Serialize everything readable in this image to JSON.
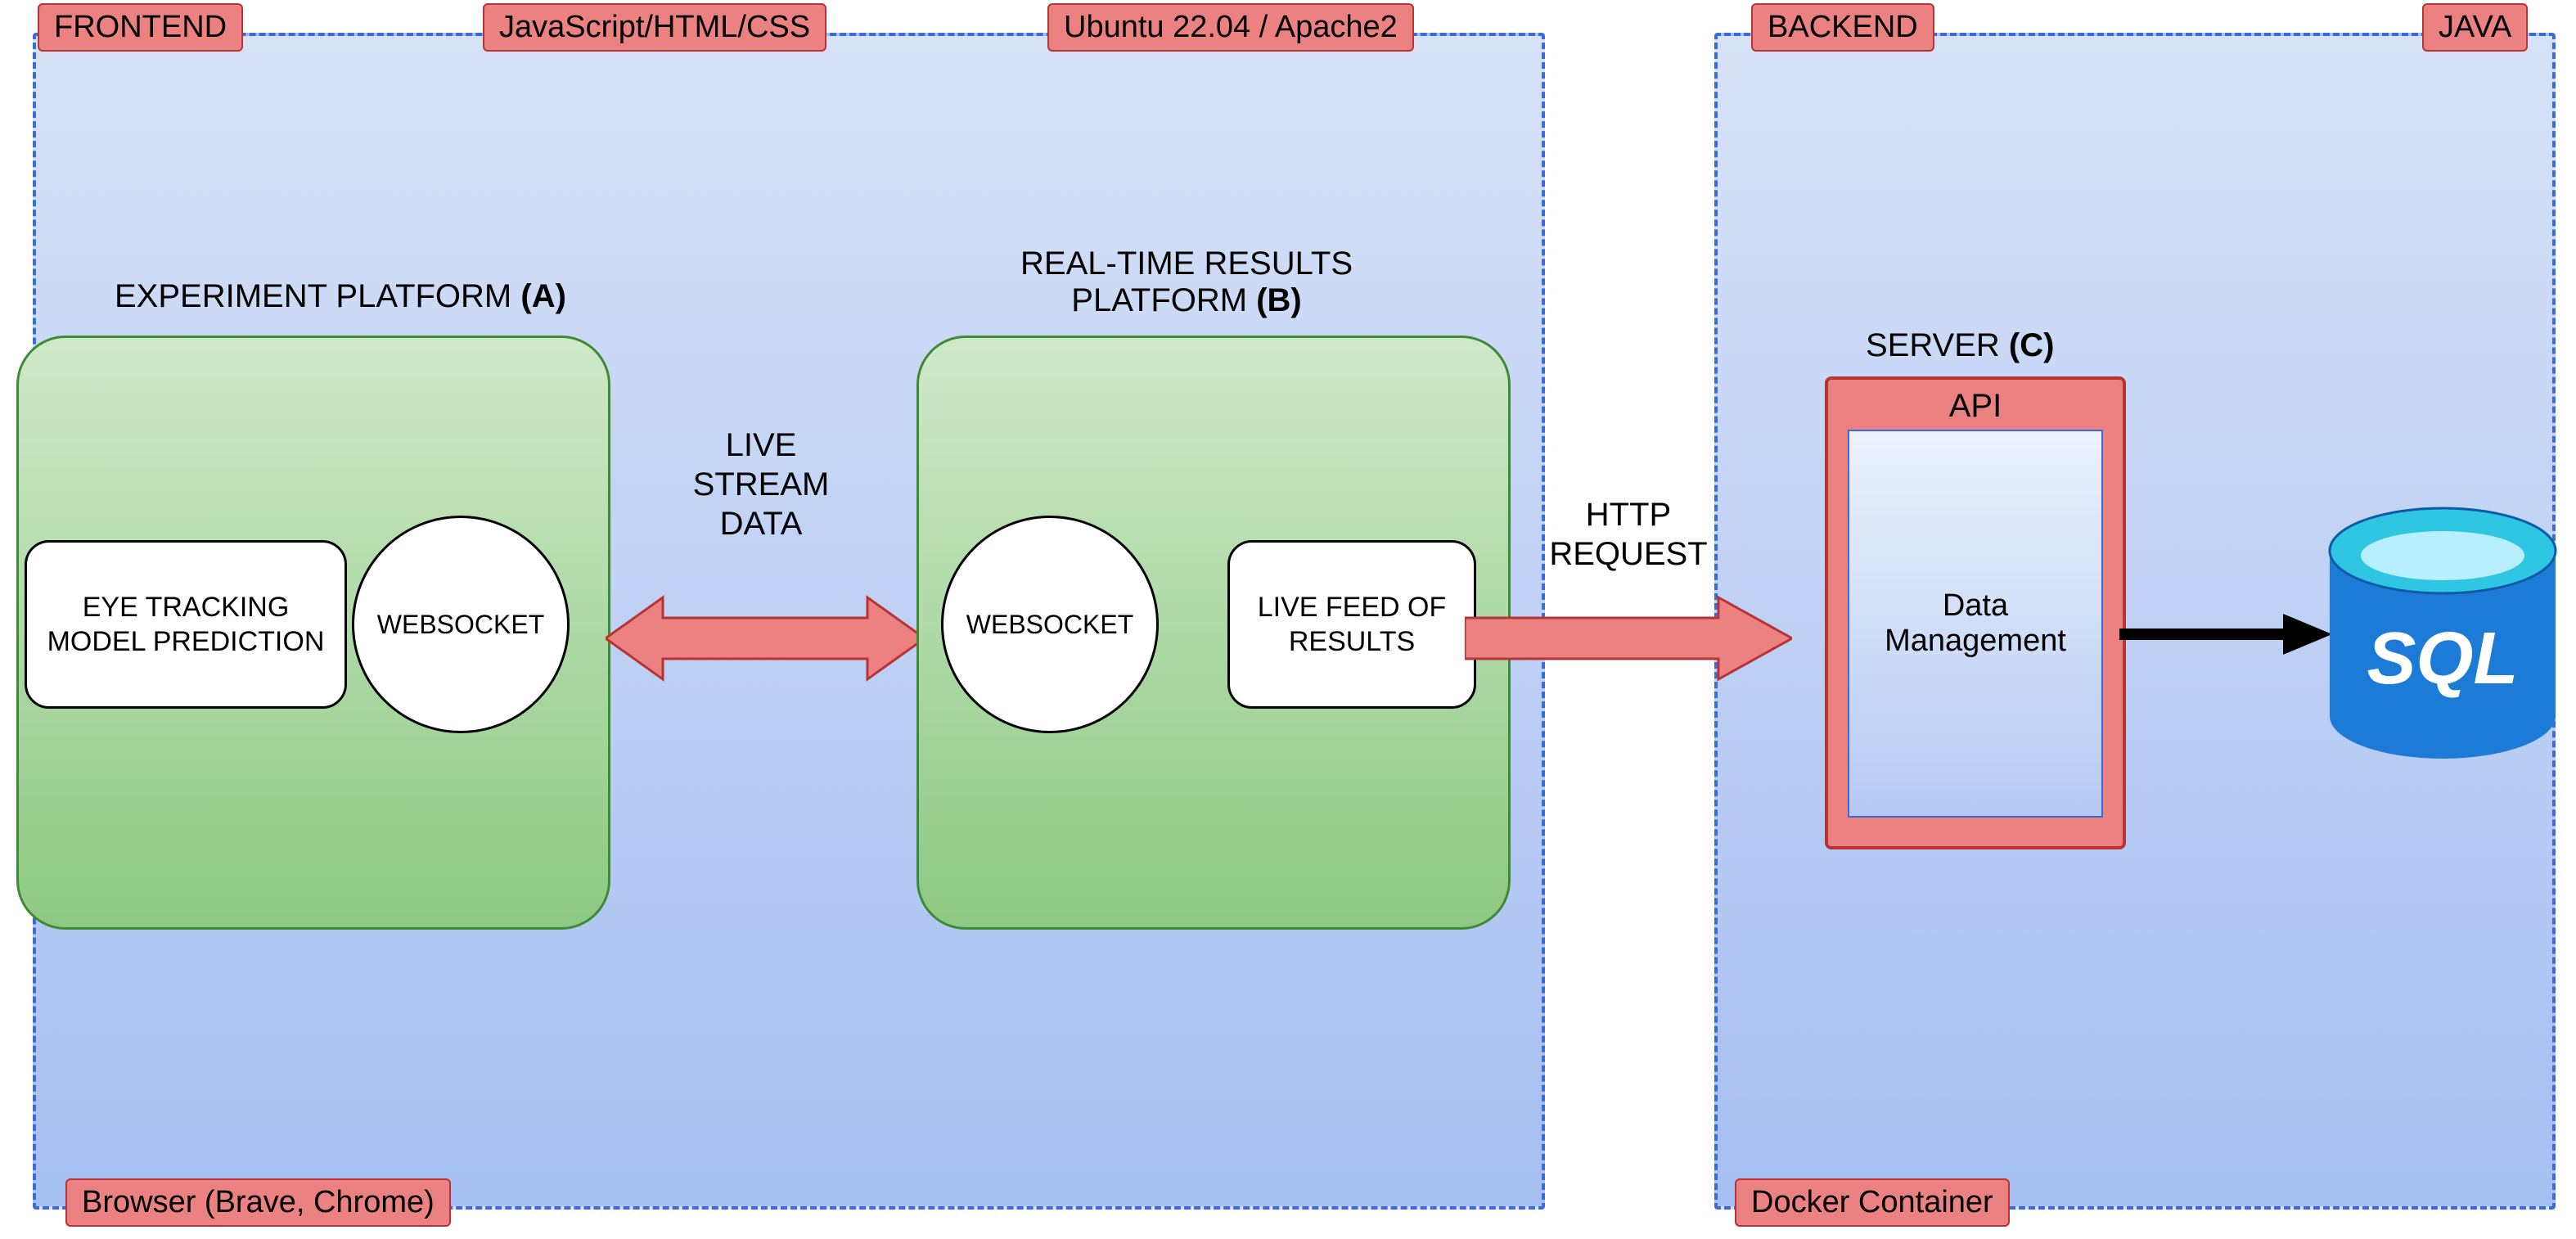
{
  "tags": {
    "frontend": "FRONTEND",
    "js_html_css": "JavaScript/HTML/CSS",
    "ubuntu_apache": "Ubuntu 22.04 / Apache2",
    "backend": "BACKEND",
    "java": "JAVA",
    "browser": "Browser (Brave, Chrome)",
    "docker": "Docker Container"
  },
  "titles": {
    "experiment_platform": "EXPERIMENT PLATFORM ",
    "experiment_platform_bold": "(A)",
    "realtime_platform_l1": "REAL-TIME RESULTS",
    "realtime_platform_l2": "PLATFORM ",
    "realtime_platform_bold": "(B)",
    "server": "SERVER ",
    "server_bold": "(C)"
  },
  "nodes": {
    "eye_tracking": "EYE TRACKING MODEL PREDICTION",
    "websocket_a": "WEBSOCKET",
    "websocket_b": "WEBSOCKET",
    "live_feed": "LIVE FEED OF RESULTS",
    "api_title": "API",
    "data_mgmt_l1": "Data",
    "data_mgmt_l2": "Management",
    "sql": "SQL"
  },
  "labels": {
    "live_stream_l1": "LIVE",
    "live_stream_l2": "STREAM",
    "live_stream_l3": "DATA",
    "http_l1": "HTTP",
    "http_l2": "REQUEST"
  },
  "colors": {
    "red_fill": "#ec8181",
    "red_stroke": "#b83333",
    "blue_cyl_top": "#2fc6e3",
    "blue_cyl_body": "#1d7bd8"
  }
}
